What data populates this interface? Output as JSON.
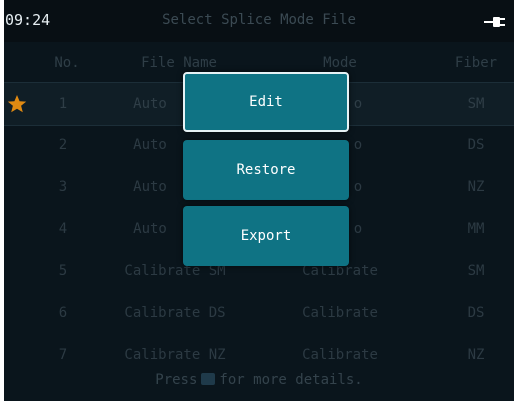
{
  "status": {
    "time": "09:24",
    "title": "Select Splice Mode File",
    "power_icon": "plug-icon"
  },
  "columns": {
    "no": "No.",
    "file_name": "File Name",
    "mode": "Mode",
    "fiber": "Fiber"
  },
  "rows": [
    {
      "no": "1",
      "name": "Auto",
      "mode": "o",
      "fiber": "SM",
      "starred": true
    },
    {
      "no": "2",
      "name": "Auto",
      "mode": "o",
      "fiber": "DS"
    },
    {
      "no": "3",
      "name": "Auto",
      "mode": "o",
      "fiber": "NZ"
    },
    {
      "no": "4",
      "name": "Auto",
      "mode": "o",
      "fiber": "MM"
    },
    {
      "no": "5",
      "name": "Calibrate SM",
      "mode": "Calibrate",
      "fiber": "SM"
    },
    {
      "no": "6",
      "name": "Calibrate DS",
      "mode": "Calibrate",
      "fiber": "DS"
    },
    {
      "no": "7",
      "name": "Calibrate NZ",
      "mode": "Calibrate",
      "fiber": "NZ"
    }
  ],
  "footer": {
    "press": "Press",
    "rest": "for more details."
  },
  "menu": {
    "edit": "Edit",
    "restore": "Restore",
    "export": "Export"
  },
  "colors": {
    "accent": "#0f7384",
    "star": "#e08a12",
    "background": "#0a151c"
  }
}
